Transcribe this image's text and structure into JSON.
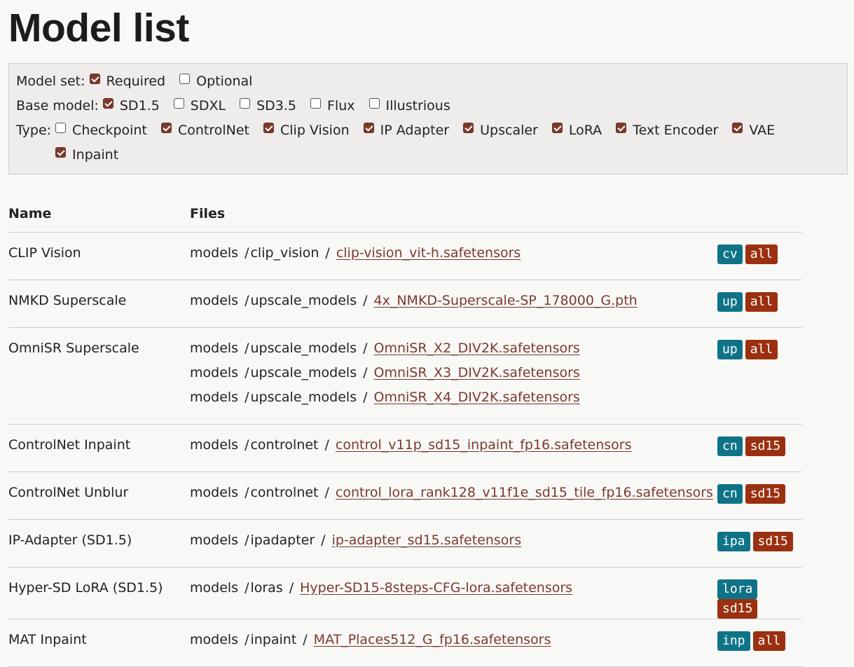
{
  "page_title": "Model list",
  "filters": {
    "model_set": {
      "label": "Model set:",
      "options": [
        {
          "label": "Required",
          "checked": true
        },
        {
          "label": "Optional",
          "checked": false
        }
      ]
    },
    "base_model": {
      "label": "Base model:",
      "options": [
        {
          "label": "SD1.5",
          "checked": true
        },
        {
          "label": "SDXL",
          "checked": false
        },
        {
          "label": "SD3.5",
          "checked": false
        },
        {
          "label": "Flux",
          "checked": false
        },
        {
          "label": "Illustrious",
          "checked": false
        }
      ]
    },
    "type": {
      "label": "Type:",
      "options": [
        {
          "label": "Checkpoint",
          "checked": false
        },
        {
          "label": "ControlNet",
          "checked": true
        },
        {
          "label": "Clip Vision",
          "checked": true
        },
        {
          "label": "IP Adapter",
          "checked": true
        },
        {
          "label": "Upscaler",
          "checked": true
        },
        {
          "label": "LoRA",
          "checked": true
        },
        {
          "label": "Text Encoder",
          "checked": true
        },
        {
          "label": "VAE",
          "checked": true
        },
        {
          "label": "Inpaint",
          "checked": true
        }
      ]
    }
  },
  "table": {
    "headers": {
      "name": "Name",
      "files": "Files"
    },
    "rows": [
      {
        "name": "CLIP Vision",
        "files": [
          {
            "root": "models",
            "folder": "clip_vision",
            "file": "clip-vision_vit-h.safetensors"
          }
        ],
        "tags": [
          "cv",
          "all"
        ]
      },
      {
        "name": "NMKD Superscale",
        "files": [
          {
            "root": "models",
            "folder": "upscale_models",
            "file": "4x_NMKD-Superscale-SP_178000_G.pth"
          }
        ],
        "tags": [
          "up",
          "all"
        ]
      },
      {
        "name": "OmniSR Superscale",
        "files": [
          {
            "root": "models",
            "folder": "upscale_models",
            "file": "OmniSR_X2_DIV2K.safetensors"
          },
          {
            "root": "models",
            "folder": "upscale_models",
            "file": "OmniSR_X3_DIV2K.safetensors"
          },
          {
            "root": "models",
            "folder": "upscale_models",
            "file": "OmniSR_X4_DIV2K.safetensors"
          }
        ],
        "tags": [
          "up",
          "all"
        ]
      },
      {
        "name": "ControlNet Inpaint",
        "files": [
          {
            "root": "models",
            "folder": "controlnet",
            "file": "control_v11p_sd15_inpaint_fp16.safetensors"
          }
        ],
        "tags": [
          "cn",
          "sd15"
        ]
      },
      {
        "name": "ControlNet Unblur",
        "files": [
          {
            "root": "models",
            "folder": "controlnet",
            "file": "control_lora_rank128_v11f1e_sd15_tile_fp16.safetensors"
          }
        ],
        "tags": [
          "cn",
          "sd15"
        ]
      },
      {
        "name": "IP-Adapter (SD1.5)",
        "files": [
          {
            "root": "models",
            "folder": "ipadapter",
            "file": "ip-adapter_sd15.safetensors"
          }
        ],
        "tags": [
          "ipa",
          "sd15"
        ]
      },
      {
        "name": "Hyper-SD LoRA (SD1.5)",
        "files": [
          {
            "root": "models",
            "folder": "loras",
            "file": "Hyper-SD15-8steps-CFG-lora.safetensors"
          }
        ],
        "tags": [
          "lora",
          "sd15"
        ]
      },
      {
        "name": "MAT Inpaint",
        "files": [
          {
            "root": "models",
            "folder": "inpaint",
            "file": "MAT_Places512_G_fp16.safetensors"
          }
        ],
        "tags": [
          "inp",
          "all"
        ]
      }
    ]
  },
  "colors": {
    "type_tag": "#0f7388",
    "category_tag": "#9b3010",
    "link": "#7b3a2c",
    "checkbox": "#7b3a2c"
  }
}
